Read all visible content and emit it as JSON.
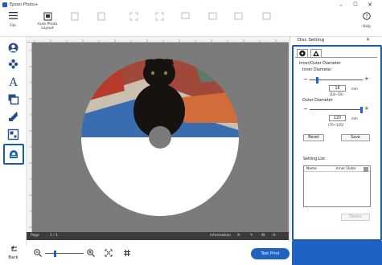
{
  "app": {
    "title": "Epson Photo+"
  },
  "window_controls": {
    "minimize": "–",
    "maximize": "☐",
    "close": "✕"
  },
  "toolbar": {
    "file": "File",
    "auto_photo_layout_1": "Auto Photo",
    "auto_photo_layout_2": "Layout",
    "help": "Help"
  },
  "status": {
    "page": "Page",
    "page_num": "1 / 1",
    "information": "Information",
    "x": "X-",
    "y": "Y-",
    "w": "W-",
    "h": "H-"
  },
  "bottom": {
    "back": "Back",
    "test_print": "Test Print"
  },
  "panel": {
    "title": "Disc Setting",
    "close": "✕",
    "section_title": "Inner/Outer Diameter",
    "inner_label": "Inner Diameter",
    "inner_value": "18",
    "inner_unit": "mm",
    "inner_range": "(18~50)",
    "inner_level": 0.0,
    "outer_label": "Outer Diameter",
    "outer_value": "120",
    "outer_unit": "mm",
    "outer_range": "(70~120)",
    "outer_level": 1.0,
    "reset": "Reset",
    "save": "Save",
    "setting_list": "Setting List",
    "col_name": "Name",
    "col_inner_outer": "Inner Outer",
    "delete": "Delete"
  },
  "zoom": {
    "level": 0.25
  },
  "colors": {
    "accent": "#1e63c4",
    "frame": "#1b5aa6",
    "canvas": "#7b7b7b",
    "statusbar": "#3b3b3b"
  }
}
